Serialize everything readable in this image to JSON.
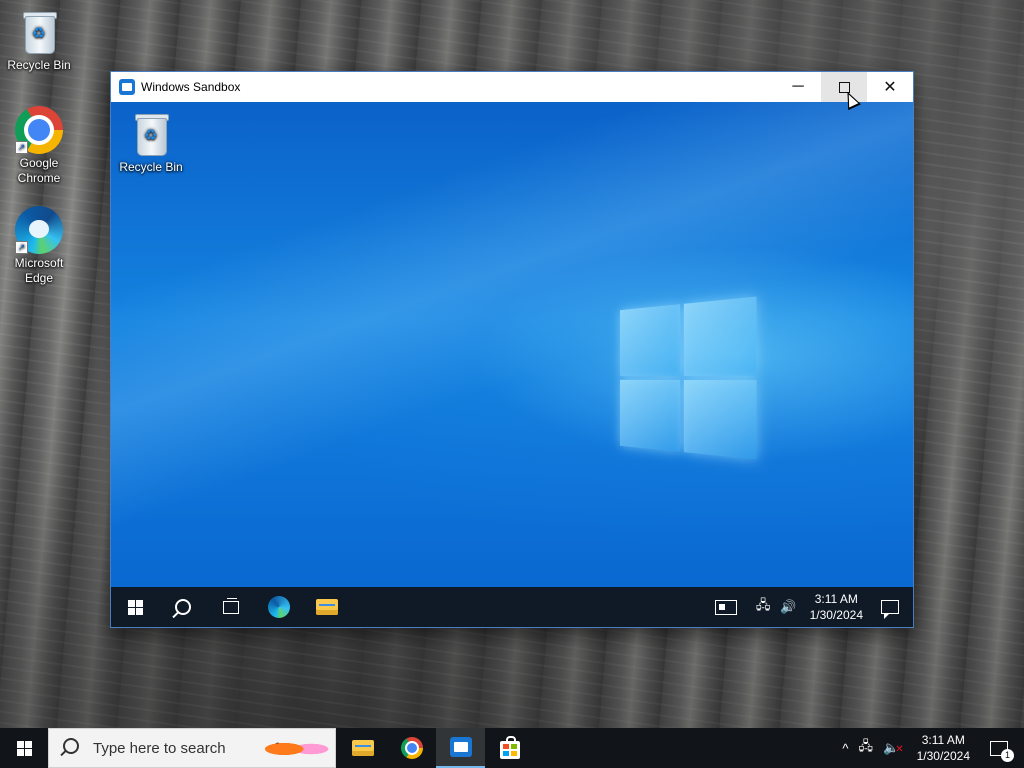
{
  "desktop": {
    "icons": [
      {
        "label": "Recycle Bin"
      },
      {
        "label": "Google Chrome"
      },
      {
        "label": "Microsoft Edge"
      }
    ]
  },
  "window": {
    "title": "Windows Sandbox",
    "controls": {
      "minimize": "─",
      "close": "✕"
    }
  },
  "sandbox": {
    "icons": [
      {
        "label": "Recycle Bin"
      }
    ],
    "taskbar": {
      "time": "3:11 AM",
      "date": "1/30/2024"
    }
  },
  "host_taskbar": {
    "search_placeholder": "Type here to search",
    "time": "3:11 AM",
    "date": "1/30/2024",
    "notification_count": "1",
    "tray_chevron": "^"
  },
  "colors": {
    "sandbox_wallpaper": "#1483e0",
    "taskbar": "#111418",
    "accent": "#76b9ed"
  }
}
